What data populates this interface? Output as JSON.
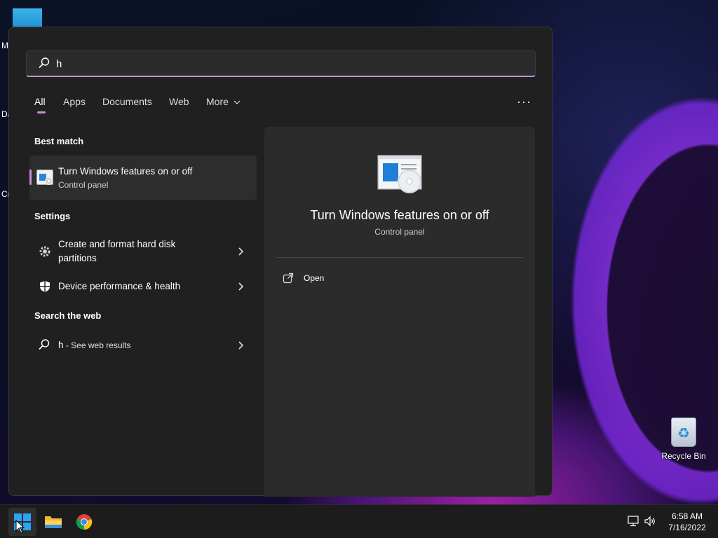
{
  "search": {
    "query": "h",
    "icon": "search-icon"
  },
  "tabs": [
    {
      "label": "All",
      "active": true
    },
    {
      "label": "Apps"
    },
    {
      "label": "Documents"
    },
    {
      "label": "Web"
    },
    {
      "label": "More"
    }
  ],
  "sections": {
    "best_match": "Best match",
    "settings": "Settings",
    "search_web": "Search the web"
  },
  "best_match": {
    "title": "Turn Windows features on or off",
    "subtitle": "Control panel",
    "icon": "windows-features-icon"
  },
  "settings": [
    {
      "line1": "Create and format hard disk",
      "line2": "partitions",
      "icon": "gear-icon"
    },
    {
      "label": "Device performance & health",
      "icon": "shield-icon"
    }
  ],
  "web": {
    "query": "h",
    "suffix": " - See web results",
    "icon": "search-icon"
  },
  "detail": {
    "title": "Turn Windows features on or off",
    "subtitle": "Control panel",
    "open_label": "Open"
  },
  "desktop": {
    "recycle_bin": "Recycle Bin",
    "partial_labels": [
      "M",
      "Da",
      "Cr"
    ]
  },
  "taskbar": {
    "time": "6:58 AM",
    "date": "7/16/2022",
    "apps": [
      "start-button",
      "file-explorer",
      "chrome"
    ]
  },
  "colors": {
    "accent": "#c691d8",
    "panel": "#202020",
    "detail": "#2b2b2b"
  }
}
